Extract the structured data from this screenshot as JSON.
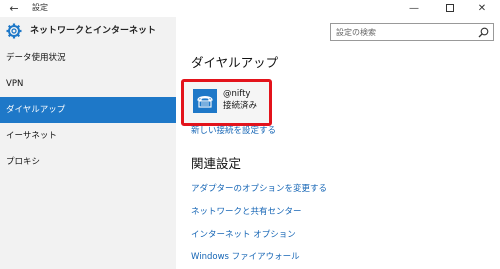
{
  "window": {
    "back_glyph": "←",
    "title": "設定",
    "minimize_glyph": "—",
    "close_glyph": "✕"
  },
  "header": {
    "title": "ネットワークとインターネット",
    "icon": "gear-icon"
  },
  "search": {
    "placeholder": "設定の検索",
    "icon": "search-icon"
  },
  "sidebar": {
    "items": [
      {
        "label": "データ使用状況"
      },
      {
        "label": "VPN"
      },
      {
        "label": "ダイヤルアップ"
      },
      {
        "label": "イーサネット"
      },
      {
        "label": "プロキシ"
      }
    ],
    "active_index": 2
  },
  "main": {
    "title": "ダイヤルアップ",
    "connection": {
      "name": "@nifty",
      "status": "接続済み",
      "icon": "dialup-phone-icon"
    },
    "setup_link": "新しい接続を設定する",
    "related_title": "関連設定",
    "related_links": [
      "アダプターのオプションを変更する",
      "ネットワークと共有センター",
      "インターネット オプション",
      "Windows ファイアウォール"
    ]
  },
  "colors": {
    "accent": "#1e78c8",
    "highlight_border": "#e3131b",
    "link": "#1565b5",
    "sidebar_bg": "#f2f2f2"
  }
}
